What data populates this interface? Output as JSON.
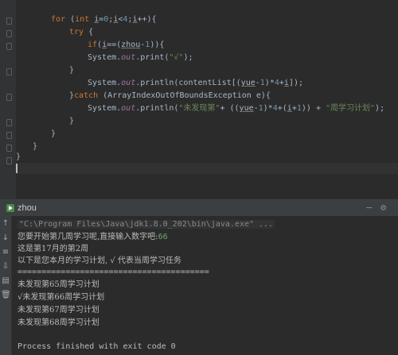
{
  "editor": {
    "lines": {
      "l1": {
        "kw": "for",
        "rest1": " (",
        "kw2": "int",
        "rest2": " ",
        "var_i": "i",
        "rest3": "=",
        "n0": "0",
        "rest4": ";",
        "var_i2": "i",
        "rest5": "<",
        "n4": "4",
        "rest6": ";",
        "var_i3": "i",
        "rest7": "++){"
      },
      "l2": {
        "kw": "try",
        "rest": " {"
      },
      "l3": {
        "kw": "if",
        "p1": "(",
        "var": "i",
        "p2": "==(",
        "zhou": "zhou",
        "p3": "-",
        "n1": "1",
        "p4": ")){"
      },
      "l4": {
        "cls": "System.",
        "out": "out",
        "m": ".print(",
        "s": "\"√\"",
        "end": ");"
      },
      "l5": "}",
      "l6": {
        "cls": "System.",
        "out": "out",
        "m": ".println(contentList[(",
        "yue": "yue",
        "p1": "-",
        "n1": "1",
        "p2": ")*",
        "n4": "4",
        "p3": "+",
        "i": "i",
        "end": "]);"
      },
      "l7": {
        "p1": "}",
        "kw": "catch",
        "rest": " (ArrayIndexOutOfBoundsException e){"
      },
      "l8": {
        "cls": "System.",
        "out": "out",
        "m": ".println(",
        "s1": "\"未发现第\"",
        "p1": "+ ((",
        "yue": "yue",
        "p2": "-",
        "n1": "1",
        "p3": ")*",
        "n4": "4",
        "p4": "+(",
        "i": "i",
        "p5": "+",
        "n1b": "1",
        "p6": ")) + ",
        "s2": "\"周学习计划\"",
        "end": ");"
      },
      "l9": "}",
      "l10": "}",
      "l11": "}",
      "l12": "}"
    }
  },
  "run_panel": {
    "tab_label": "zhou",
    "gear_icon": "gear-icon",
    "minimize_icon": "minimize-icon"
  },
  "console": {
    "command": "\"C:\\Program Files\\Java\\jdk1.8.0_202\\bin\\java.exe\" ...",
    "prompt": "您要开始第几周学习呢,直接输入数字吧:",
    "prompt_input": "66",
    "line3": "这是第17月的第2周",
    "line4": "以下是您本月的学习计划, √ 代表当周学习任务",
    "separator": "========================================",
    "plan1": "未发现第65周学习计划",
    "plan2": "√未发现第66周学习计划",
    "plan3": "未发现第67周学习计划",
    "plan4": "未发现第68周学习计划",
    "exit": "Process finished with exit code 0"
  },
  "colors": {
    "background": "#2b2b2b",
    "keyword": "#cc7832",
    "number": "#6897bb",
    "string": "#6a8759",
    "field": "#9876aa",
    "text": "#a9b7c6",
    "user_input": "#6aab73"
  }
}
